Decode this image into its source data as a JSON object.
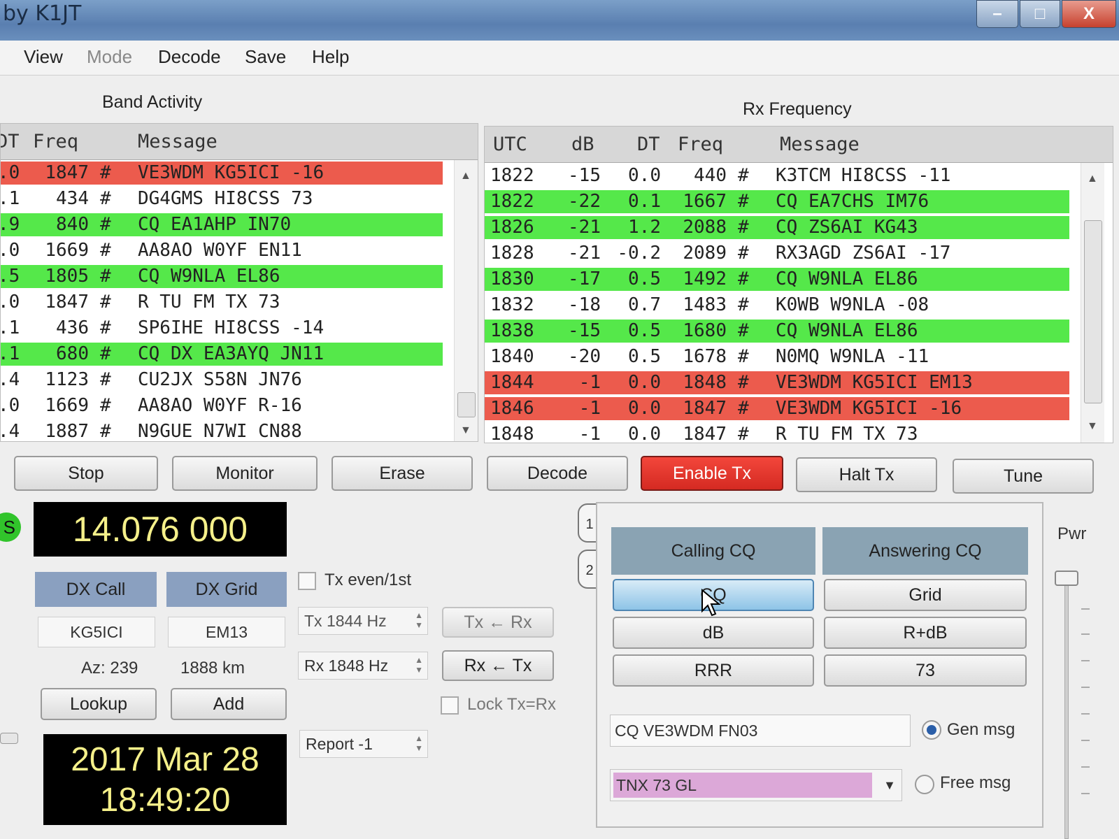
{
  "window": {
    "title": "by K1JT",
    "minimize": "–",
    "maximize": "□",
    "close": "X"
  },
  "menu": [
    "View",
    "Mode",
    "Decode",
    "Save",
    "Help"
  ],
  "band_activity": {
    "label": "Band Activity",
    "columns": [
      "DT",
      "Freq",
      "Message"
    ],
    "rows": [
      {
        "dt": ".0",
        "freq": "1847",
        "flag": "#",
        "msg": "VE3WDM KG5ICI -16",
        "hl": "red"
      },
      {
        "dt": ".1",
        "freq": "434",
        "flag": "#",
        "msg": "DG4GMS HI8CSS 73",
        "hl": ""
      },
      {
        "dt": ".9",
        "freq": "840",
        "flag": "#",
        "msg": "CQ EA1AHP IN70",
        "hl": "green"
      },
      {
        "dt": ".0",
        "freq": "1669",
        "flag": "#",
        "msg": "AA8AO W0YF EN11",
        "hl": ""
      },
      {
        "dt": ".5",
        "freq": "1805",
        "flag": "#",
        "msg": "CQ W9NLA EL86",
        "hl": "green"
      },
      {
        "dt": ".0",
        "freq": "1847",
        "flag": "#",
        "msg": "R TU FM TX 73",
        "hl": ""
      },
      {
        "dt": ".1",
        "freq": "436",
        "flag": "#",
        "msg": "SP6IHE HI8CSS -14",
        "hl": ""
      },
      {
        "dt": ".1",
        "freq": "680",
        "flag": "#",
        "msg": "CQ DX EA3AYQ JN11",
        "hl": "green"
      },
      {
        "dt": ".4",
        "freq": "1123",
        "flag": "#",
        "msg": "CU2JX S58N JN76",
        "hl": ""
      },
      {
        "dt": ".0",
        "freq": "1669",
        "flag": "#",
        "msg": "AA8AO W0YF R-16",
        "hl": ""
      },
      {
        "dt": ".4",
        "freq": "1887",
        "flag": "#",
        "msg": "N9GUE N7WI CN88",
        "hl": ""
      }
    ]
  },
  "rx_frequency": {
    "label": "Rx Frequency",
    "columns": [
      "UTC",
      "dB",
      "DT",
      "Freq",
      "Message"
    ],
    "rows": [
      {
        "utc": "1822",
        "db": "-15",
        "dt": "0.0",
        "freq": "440",
        "flag": "#",
        "msg": "K3TCM HI8CSS -11",
        "hl": ""
      },
      {
        "utc": "1822",
        "db": "-22",
        "dt": "0.1",
        "freq": "1667",
        "flag": "#",
        "msg": "CQ EA7CHS IM76",
        "hl": "green"
      },
      {
        "utc": "1826",
        "db": "-21",
        "dt": "1.2",
        "freq": "2088",
        "flag": "#",
        "msg": "CQ ZS6AI KG43",
        "hl": "green"
      },
      {
        "utc": "1828",
        "db": "-21",
        "dt": "-0.2",
        "freq": "2089",
        "flag": "#",
        "msg": "RX3AGD ZS6AI -17",
        "hl": ""
      },
      {
        "utc": "1830",
        "db": "-17",
        "dt": "0.5",
        "freq": "1492",
        "flag": "#",
        "msg": "CQ W9NLA EL86",
        "hl": "green"
      },
      {
        "utc": "1832",
        "db": "-18",
        "dt": "0.7",
        "freq": "1483",
        "flag": "#",
        "msg": "K0WB W9NLA -08",
        "hl": ""
      },
      {
        "utc": "1838",
        "db": "-15",
        "dt": "0.5",
        "freq": "1680",
        "flag": "#",
        "msg": "CQ W9NLA EL86",
        "hl": "green"
      },
      {
        "utc": "1840",
        "db": "-20",
        "dt": "0.5",
        "freq": "1678",
        "flag": "#",
        "msg": "N0MQ W9NLA -11",
        "hl": ""
      },
      {
        "utc": "1844",
        "db": "-1",
        "dt": "0.0",
        "freq": "1848",
        "flag": "#",
        "msg": "VE3WDM KG5ICI EM13",
        "hl": "red"
      },
      {
        "utc": "1846",
        "db": "-1",
        "dt": "0.0",
        "freq": "1847",
        "flag": "#",
        "msg": "VE3WDM KG5ICI -16",
        "hl": "red"
      },
      {
        "utc": "1848",
        "db": "-1",
        "dt": "0.0",
        "freq": "1847",
        "flag": "#",
        "msg": "R TU FM TX 73",
        "hl": ""
      }
    ]
  },
  "controls": {
    "stop": "Stop",
    "monitor": "Monitor",
    "erase": "Erase",
    "decode": "Decode",
    "enable_tx": "Enable Tx",
    "halt_tx": "Halt Tx",
    "tune": "Tune"
  },
  "dial_freq": "14.076 000",
  "lamp_label": "S",
  "dx": {
    "call_label": "DX Call",
    "grid_label": "DX Grid",
    "call": "KG5ICI",
    "grid": "EM13",
    "az": "Az: 239",
    "dist": "1888 km",
    "lookup": "Lookup",
    "add": "Add"
  },
  "date": "2017 Mar 28",
  "time": "18:49:20",
  "tx_even": "Tx even/1st",
  "tx_freq": "Tx  1844  Hz",
  "rx_freq": "Rx  1848  Hz",
  "tx_from_rx": "Tx ← Rx",
  "rx_from_tx": "Rx ← Tx",
  "lock": "Lock Tx=Rx",
  "report": "Report -1",
  "tabs": [
    "1",
    "2"
  ],
  "msg_panel": {
    "calling": "Calling CQ",
    "answering": "Answering CQ",
    "buttons": [
      "CQ",
      "Grid",
      "dB",
      "R+dB",
      "RRR",
      "73"
    ],
    "gen_text": "CQ VE3WDM FN03",
    "gen_label": "Gen msg",
    "free_text": "TNX 73 GL",
    "free_label": "Free msg"
  },
  "pwr_label": "Pwr",
  "colors": {
    "green": "#55e84a",
    "red": "#ec5b4d",
    "enable_tx": "#e2342a"
  }
}
